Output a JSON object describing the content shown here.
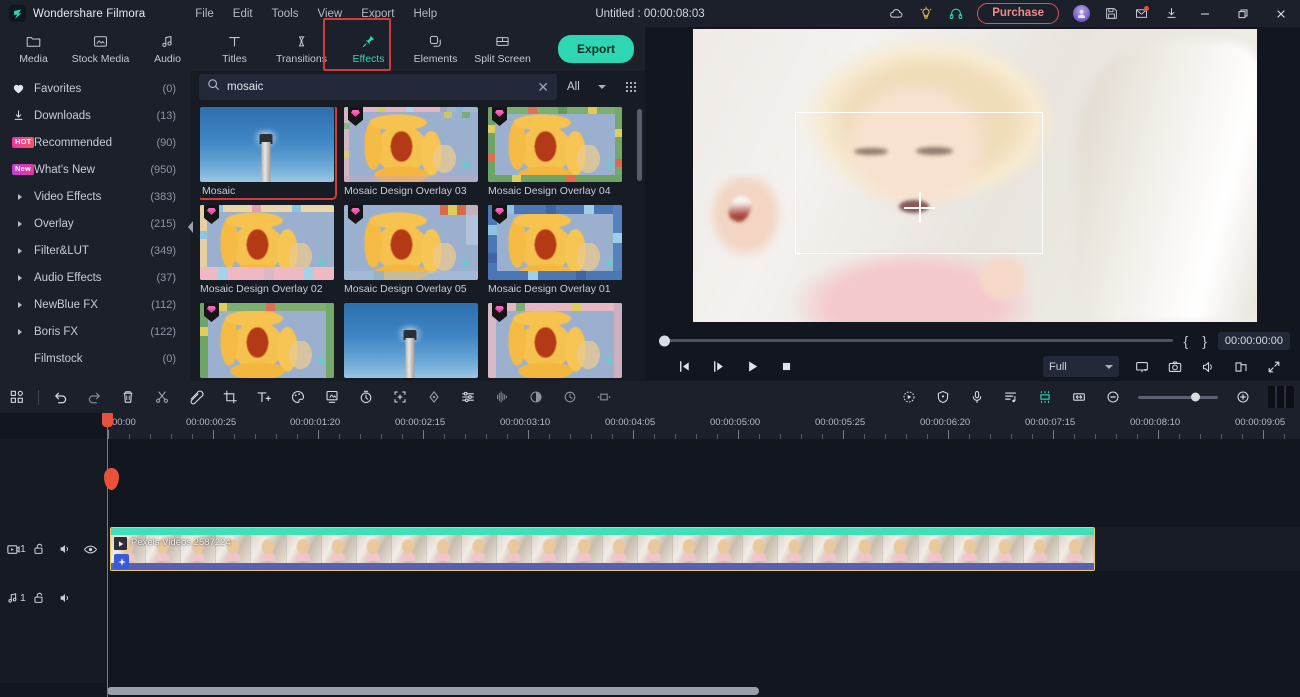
{
  "app": {
    "brand": "Wondershare Filmora",
    "document_title": "Untitled : 00:00:08:03"
  },
  "menubar": [
    "File",
    "Edit",
    "Tools",
    "View",
    "Export",
    "Help"
  ],
  "titlebar_icons": [
    {
      "name": "cloud-icon",
      "label": "cloud"
    },
    {
      "name": "lightbulb-icon",
      "label": "tips"
    },
    {
      "name": "headphones-icon",
      "label": "support"
    }
  ],
  "purchase": {
    "label": "Purchase"
  },
  "window_controls": {
    "minimize": "—",
    "maximize": "❐",
    "close": "✕"
  },
  "toolbar_tabs": [
    {
      "label": "Media",
      "icon": "folder-icon",
      "active": false
    },
    {
      "label": "Stock Media",
      "icon": "image-stack-icon",
      "active": false
    },
    {
      "label": "Audio",
      "icon": "music-note-icon",
      "active": false
    },
    {
      "label": "Titles",
      "icon": "text-t-icon",
      "active": false
    },
    {
      "label": "Transitions",
      "icon": "transition-arrows-icon",
      "active": false
    },
    {
      "label": "Effects",
      "icon": "effects-pin-icon",
      "active": true
    },
    {
      "label": "Elements",
      "icon": "elements-layers-icon",
      "active": false
    },
    {
      "label": "Split Screen",
      "icon": "split-screen-icon",
      "active": false
    }
  ],
  "export_button": {
    "label": "Export"
  },
  "sidebar": {
    "items": [
      {
        "label": "Favorites",
        "count": "(0)",
        "icon": "heart-icon"
      },
      {
        "label": "Downloads",
        "count": "(13)",
        "icon": "download-icon"
      },
      {
        "label": "Recommended",
        "count": "(90)",
        "icon": "hot-badge",
        "tag": "HOT"
      },
      {
        "label": "What's New",
        "count": "(950)",
        "icon": "new-badge",
        "tag": "New"
      },
      {
        "label": "Video Effects",
        "count": "(383)",
        "icon": "caret-right-icon"
      },
      {
        "label": "Overlay",
        "count": "(215)",
        "icon": "caret-right-icon"
      },
      {
        "label": "Filter&LUT",
        "count": "(349)",
        "icon": "caret-right-icon"
      },
      {
        "label": "Audio Effects",
        "count": "(37)",
        "icon": "caret-right-icon"
      },
      {
        "label": "NewBlue FX",
        "count": "(112)",
        "icon": "caret-right-icon"
      },
      {
        "label": "Boris FX",
        "count": "(122)",
        "icon": "caret-right-icon"
      },
      {
        "label": "Filmstock",
        "count": "(0)",
        "icon": "none"
      }
    ]
  },
  "search": {
    "value": "mosaic",
    "placeholder": "Search",
    "filter_label": "All"
  },
  "effects_grid": [
    {
      "name": "Mosaic",
      "thumb": "lighthouse",
      "selected": true,
      "premium": false,
      "download": false
    },
    {
      "name": "Mosaic Design Overlay 03",
      "thumb": "flower",
      "selected": false,
      "premium": true,
      "download": true
    },
    {
      "name": "Mosaic Design Overlay 04",
      "thumb": "flower",
      "selected": false,
      "premium": true,
      "download": true
    },
    {
      "name": "Mosaic Design Overlay 02",
      "thumb": "flower",
      "selected": false,
      "premium": true,
      "download": true
    },
    {
      "name": "Mosaic Design Overlay 05",
      "thumb": "flower",
      "selected": false,
      "premium": true,
      "download": true
    },
    {
      "name": "Mosaic Design Overlay 01",
      "thumb": "flower",
      "selected": false,
      "premium": true,
      "download": true
    },
    {
      "name": "",
      "thumb": "flower",
      "selected": false,
      "premium": true,
      "download": true
    },
    {
      "name": "",
      "thumb": "lighthouse",
      "selected": false,
      "premium": false,
      "download": false
    },
    {
      "name": "",
      "thumb": "flower",
      "selected": false,
      "premium": true,
      "download": true
    }
  ],
  "preview": {
    "timecode": "00:00:00:00",
    "quality": "Full",
    "mark_in": "{",
    "mark_out": "}",
    "controls": [
      {
        "name": "prev-frame-button",
        "icon": "step-back-icon"
      },
      {
        "name": "next-frame-button",
        "icon": "step-forward-icon"
      },
      {
        "name": "play-button",
        "icon": "play-icon"
      },
      {
        "name": "stop-button",
        "icon": "stop-icon"
      }
    ],
    "right_controls": [
      {
        "name": "pop-out-player-button",
        "icon": "monitor-icon"
      },
      {
        "name": "snapshot-button",
        "icon": "camera-icon"
      },
      {
        "name": "volume-button",
        "icon": "speaker-icon"
      },
      {
        "name": "render-preview-button",
        "icon": "folder-open-icon"
      },
      {
        "name": "fullscreen-button",
        "icon": "expand-arrows-icon"
      }
    ]
  },
  "timeline_toolbar": {
    "left_icons": [
      {
        "name": "project-media-button",
        "icon": "grid-squares-icon"
      },
      {
        "name": "undo-button",
        "icon": "undo-arrow-icon"
      },
      {
        "name": "redo-button",
        "icon": "redo-arrow-icon"
      },
      {
        "name": "delete-button",
        "icon": "trash-icon"
      },
      {
        "name": "split-button",
        "icon": "scissors-icon"
      },
      {
        "name": "marker-button",
        "icon": "tag-icon"
      },
      {
        "name": "crop-button",
        "icon": "crop-icon"
      },
      {
        "name": "add-text-button",
        "icon": "text-plus-icon"
      },
      {
        "name": "color-match-button",
        "icon": "palette-icon"
      },
      {
        "name": "green-screen-button",
        "icon": "green-screen-icon"
      },
      {
        "name": "speed-button",
        "icon": "stopwatch-icon"
      },
      {
        "name": "auto-reframe-button",
        "icon": "reframe-brackets-icon"
      },
      {
        "name": "keyframe-button",
        "icon": "keyframe-diamond-icon"
      },
      {
        "name": "adjust-button",
        "icon": "sliders-icon"
      },
      {
        "name": "audio-mix-button",
        "icon": "waveform-icon"
      },
      {
        "name": "mask-button",
        "icon": "half-circle-icon"
      },
      {
        "name": "rotate-button",
        "icon": "rotate-icon"
      },
      {
        "name": "freeze-frame-button",
        "icon": "freeze-frame-icon"
      }
    ],
    "right_icons": [
      {
        "name": "auto-beat-sync-button",
        "icon": "beat-sync-icon"
      },
      {
        "name": "silence-detect-button",
        "icon": "shield-icon"
      },
      {
        "name": "record-voiceover-button",
        "icon": "microphone-icon"
      },
      {
        "name": "audio-list-button",
        "icon": "audio-list-icon"
      },
      {
        "name": "marker-render-button",
        "icon": "render-bar-icon"
      },
      {
        "name": "fit-timeline-button",
        "icon": "fit-width-icon"
      },
      {
        "name": "zoom-out-button",
        "icon": "minus-circle-icon"
      },
      {
        "name": "zoom-slider",
        "icon": "slider-handle"
      },
      {
        "name": "zoom-in-button",
        "icon": "plus-circle-icon"
      },
      {
        "name": "render-preview-bar",
        "icon": "render-block-icon"
      }
    ],
    "row2_icons": [
      {
        "name": "add-track-button",
        "icon": "add-track-icon"
      },
      {
        "name": "link-clips-button",
        "icon": "link-chain-icon"
      }
    ]
  },
  "ruler": {
    "labels": [
      "00:00",
      "00:00:00:25",
      "00:00:01:20",
      "00:00:02:15",
      "00:00:03:10",
      "00:00:04:05",
      "00:00:05:00",
      "00:00:05:25",
      "00:00:06:20",
      "00:00:07:15",
      "00:00:08:10",
      "00:00:09:05"
    ]
  },
  "tracks": [
    {
      "type": "video",
      "index": "1",
      "icons": [
        "video-track-icon",
        "unlock-icon",
        "mute-icon",
        "eye-icon"
      ],
      "clip": {
        "label": "Pexels Videos 2587224"
      }
    },
    {
      "type": "audio",
      "index": "1",
      "icons": [
        "audio-track-icon",
        "unlock-icon",
        "mute-icon"
      ],
      "clip": null
    }
  ],
  "colors": {
    "accent": "#2fd6b3",
    "highlight": "#d33a3a",
    "playhead": "#e8523a",
    "clip_body": "#5a5fb5",
    "clip_border": "#e8c86a",
    "panel_bg": "#1b202b"
  }
}
